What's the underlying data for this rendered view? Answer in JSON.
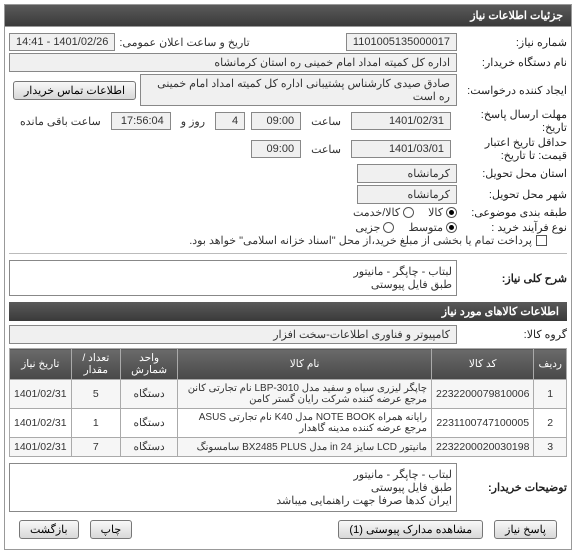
{
  "panel_title": "جزئیات اطلاعات نیاز",
  "fields": {
    "need_no_label": "شماره نیاز:",
    "need_no": "1101005135000017",
    "announce_label": "تاریخ و ساعت اعلان عمومی:",
    "announce": "1401/02/26 - 14:41",
    "buyer_label": "نام دستگاه خریدار:",
    "buyer": "اداره کل کمیته امداد امام خمینی  ره  استان کرمانشاه",
    "creator_label": "ایجاد کننده درخواست:",
    "creator": "صادق  صیدی  کارشناس پشتیبانی  اداره کل کمیته امداد امام خمینی  ره  است",
    "contact_btn": "اطلاعات تماس خریدار",
    "deadline_label": "مهلت ارسال پاسخ:",
    "deadline_sep_date": "تاریخ:",
    "deadline_date": "1401/02/31",
    "time_label": "ساعت",
    "deadline_time": "09:00",
    "day_label": "روز و",
    "days": "4",
    "remain_time": "17:56:04",
    "remain_label": "ساعت باقی مانده",
    "valid_label": "حداقل تاریخ اعتبار",
    "valid_sub": "قیمت: تا تاریخ:",
    "valid_date": "1401/03/01",
    "valid_time": "09:00",
    "delivery_prov_label": "استان محل تحویل:",
    "delivery_prov": "کرمانشاه",
    "delivery_city_label": "شهر محل تحویل:",
    "delivery_city": "کرمانشاه",
    "class_label": "طبقه بندی موضوعی:",
    "opt_kala": "کالا",
    "opt_service": "کالا/خدمت",
    "buy_type_label": "نوع فرآیند خرید :",
    "opt_med": "متوسط",
    "opt_small": "جزیی",
    "pay_note": "پرداخت تمام یا بخشی از مبلغ خرید،از محل \"اسناد خزانه اسلامی\" خواهد بود."
  },
  "need_title_label": "شرح کلی نیاز:",
  "need_title": "لبتاب - چاپگر - مانیتور\nطبق فایل پیوستی",
  "goods_header": "اطلاعات کالاهای مورد نیاز",
  "group_label": "گروه کالا:",
  "group": "کامپیوتر و فناوری اطلاعات-سخت افزار",
  "cols": {
    "row": "ردیف",
    "code": "کد کالا",
    "name": "نام کالا",
    "unit": "واحد شمارش",
    "qty": "تعداد / مقدار",
    "date": "تاریخ نیاز"
  },
  "items": [
    {
      "row": "1",
      "code": "2232200079810006",
      "name": "چاپگر لیزری سیاه و سفید مدل LBP-3010 نام تجارتی کانن مرجع عرضه کننده شرکت رایان گستر کامن",
      "unit": "دستگاه",
      "qty": "5",
      "date": "1401/02/31"
    },
    {
      "row": "2",
      "code": "2231100747100005",
      "name": "رایانه همراه NOTE BOOK مدل K40 نام تجارتی ASUS مرجع عرضه کننده مدینه گاهدار",
      "unit": "دستگاه",
      "qty": "1",
      "date": "1401/02/31"
    },
    {
      "row": "3",
      "code": "2232200020030198",
      "name": "مانیتور LCD سایز 24 in مدل BX2485 PLUS سامسونگ",
      "unit": "دستگاه",
      "qty": "7",
      "date": "1401/02/31"
    }
  ],
  "extra_label": "توضیحات خریدار:",
  "extra": "لبتاب - چاپگر - مانیتور\nطبق فایل پیوستی\nایران کدها صرفا جهت راهنمایی میباشد",
  "footer": {
    "answer": "پاسخ نیاز",
    "attach": "مشاهده مدارک پیوستی (1)",
    "print": "چاپ",
    "back": "بازگشت"
  }
}
